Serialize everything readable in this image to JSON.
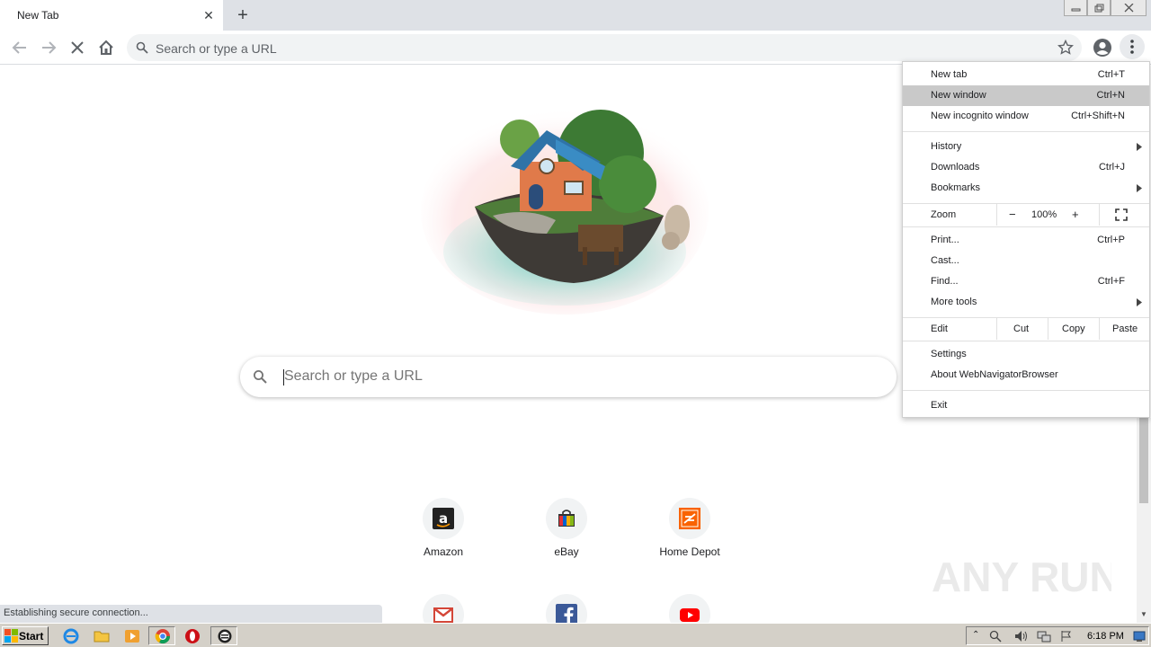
{
  "tab": {
    "title": "New Tab",
    "close": "✕",
    "new_tab": "+"
  },
  "omnibox": {
    "placeholder": "Search or type a URL"
  },
  "search": {
    "placeholder": "Search or type a URL"
  },
  "tiles": [
    {
      "label": "Amazon"
    },
    {
      "label": "eBay"
    },
    {
      "label": "Home Depot"
    }
  ],
  "status": {
    "text": "Establishing secure connection..."
  },
  "menu": {
    "new_tab": "New tab",
    "new_tab_sc": "Ctrl+T",
    "new_window": "New window",
    "new_window_sc": "Ctrl+N",
    "incognito": "New incognito window",
    "incognito_sc": "Ctrl+Shift+N",
    "history": "History",
    "downloads": "Downloads",
    "downloads_sc": "Ctrl+J",
    "bookmarks": "Bookmarks",
    "zoom": {
      "label": "Zoom",
      "minus": "−",
      "value": "100%",
      "plus": "+"
    },
    "print": "Print...",
    "print_sc": "Ctrl+P",
    "cast": "Cast...",
    "find": "Find...",
    "find_sc": "Ctrl+F",
    "more_tools": "More tools",
    "edit": {
      "label": "Edit",
      "cut": "Cut",
      "copy": "Copy",
      "paste": "Paste"
    },
    "settings": "Settings",
    "about": "About WebNavigatorBrowser",
    "exit": "Exit"
  },
  "taskbar": {
    "start": "Start",
    "clock": "6:18 PM"
  },
  "watermark": {
    "text": "ANY RUN"
  }
}
